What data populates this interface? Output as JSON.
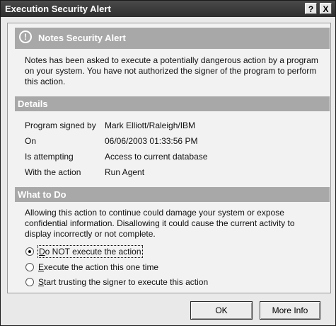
{
  "window": {
    "title": "Execution Security Alert",
    "help_glyph": "?",
    "close_glyph": "X"
  },
  "alert_section": {
    "icon": "exclamation-circle-icon",
    "title": "Notes Security Alert",
    "message": "Notes has been asked to execute a potentially dangerous action by a program on your system.  You have not authorized the signer of the program to perform this action."
  },
  "details_section": {
    "title": "Details",
    "rows": [
      {
        "label": "Program signed by",
        "value": "Mark Elliott/Raleigh/IBM"
      },
      {
        "label": "On",
        "value": "06/06/2003 01:33:56 PM"
      },
      {
        "label": "Is attempting",
        "value": "Access to current database"
      },
      {
        "label": "With the action",
        "value": "Run Agent"
      }
    ]
  },
  "what_to_do_section": {
    "title": "What to Do",
    "message": "Allowing this action to continue could damage your system or expose confidential information. Disallowing it could cause the current activity to display incorrectly or not complete.",
    "options": [
      {
        "label": "Do NOT execute the action",
        "selected": true
      },
      {
        "label": "Execute the action this one time",
        "selected": false
      },
      {
        "label": "Start trusting the signer to execute this action",
        "selected": false
      }
    ]
  },
  "buttons": {
    "ok": "OK",
    "more_info": "More Info"
  },
  "colors": {
    "header_bg": "#a8a8a8",
    "title_bar": "#2e2e2e",
    "panel_bg": "#f2f2f2"
  }
}
